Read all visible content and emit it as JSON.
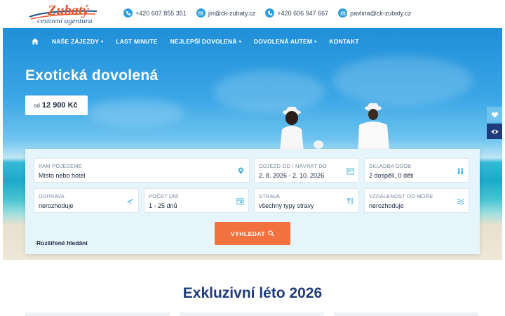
{
  "header": {
    "logo": {
      "brand": "Zubatý",
      "tagline": "cestovní agentura"
    },
    "contacts": [
      {
        "icon": "phone-icon",
        "text": "+420 607 855 351"
      },
      {
        "icon": "email-icon",
        "text": "jiri@ck-zubaty.cz"
      },
      {
        "icon": "phone-icon",
        "text": "+420 606 947 667"
      },
      {
        "icon": "email-icon",
        "text": "pavlina@ck-zubaty.cz"
      }
    ]
  },
  "nav": {
    "items": [
      {
        "label": "NAŠE ZÁJEZDY",
        "dropdown": "▾"
      },
      {
        "label": "LAST MINUTE"
      },
      {
        "label": "NEJLEPŠÍ DOVOLENÁ",
        "dropdown": "▾"
      },
      {
        "label": "DOVOLENÁ AUTEM",
        "dropdown": "▾"
      },
      {
        "label": "KONTAKT"
      }
    ]
  },
  "hero": {
    "title": "Exotická dovolená",
    "price_from": "od",
    "price_value": "12 900 Kč"
  },
  "search": {
    "destination": {
      "label": "KAM POJEDEME",
      "value": "Místo nebo hotel"
    },
    "dates": {
      "label": "ODJEZD OD / NÁVRAT DO",
      "value": "2. 8. 2026 - 2. 10. 2026"
    },
    "people": {
      "label": "SKLADBA OSOB",
      "value": "2 dospělí, 0 děti"
    },
    "transport": {
      "label": "DOPRAVA",
      "value": "nerozhoduje"
    },
    "days": {
      "label": "POČET DNÍ",
      "value": "1 - 25 dnů"
    },
    "board": {
      "label": "STRAVA",
      "value": "všechny typy stravy"
    },
    "sea_distance": {
      "label": "VZDÁLENOST OD MOŘE",
      "value": "nerozhoduje"
    },
    "submit_label": "VYHLEDAT",
    "advanced_label": "Rozšířené hledání"
  },
  "section": {
    "title": "Exkluzivní léto 2026"
  },
  "colors": {
    "accent": "#f3703f",
    "brand_blue": "#1f3c7a",
    "icon_blue": "#2f9ee0"
  }
}
